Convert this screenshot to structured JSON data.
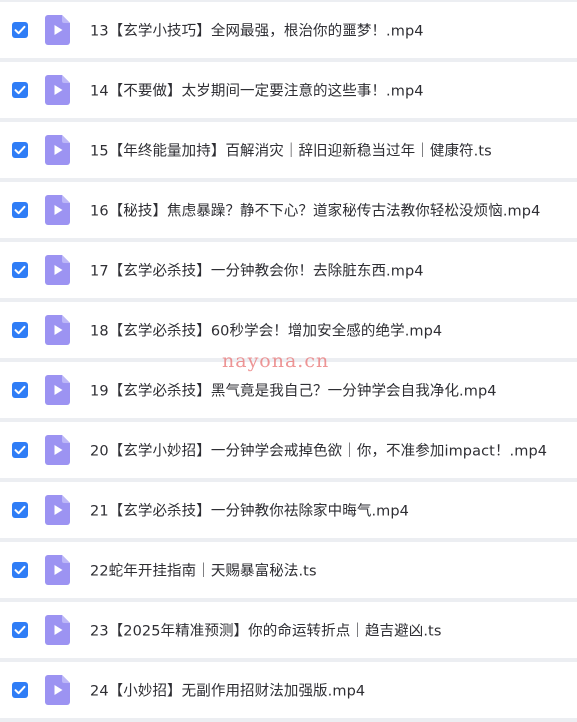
{
  "files": [
    {
      "name": "13【玄学小技巧】全网最强，根治你的噩梦！.mp4",
      "checked": true,
      "icon": "video-file-icon"
    },
    {
      "name": "14【不要做】太岁期间一定要注意的这些事！.mp4",
      "checked": true,
      "icon": "video-file-icon"
    },
    {
      "name": "15【年终能量加持】百解消灾｜辞旧迎新稳当过年｜健康符.ts",
      "checked": true,
      "icon": "video-file-icon"
    },
    {
      "name": "16【秘技】焦虑暴躁？静不下心？道家秘传古法教你轻松没烦恼.mp4",
      "checked": true,
      "icon": "video-file-icon"
    },
    {
      "name": "17【玄学必杀技】一分钟教会你！去除脏东西.mp4",
      "checked": true,
      "icon": "video-file-icon"
    },
    {
      "name": "18【玄学必杀技】60秒学会！增加安全感的绝学.mp4",
      "checked": true,
      "icon": "video-file-icon"
    },
    {
      "name": "19【玄学必杀技】黑气竟是我自己？一分钟学会自我净化.mp4",
      "checked": true,
      "icon": "video-file-icon"
    },
    {
      "name": "20【玄学小妙招】一分钟学会戒掉色欲｜你，不准参加impact！.mp4",
      "checked": true,
      "icon": "video-file-icon"
    },
    {
      "name": "21【玄学必杀技】一分钟教你祛除家中晦气.mp4",
      "checked": true,
      "icon": "video-file-icon"
    },
    {
      "name": "22蛇年开挂指南｜天赐暴富秘法.ts",
      "checked": true,
      "icon": "video-file-icon"
    },
    {
      "name": "23【2025年精准预测】你的命运转折点｜趋吉避凶.ts",
      "checked": true,
      "icon": "video-file-icon"
    },
    {
      "name": "24【小妙招】无副作用招财法加强版.mp4",
      "checked": true,
      "icon": "video-file-icon"
    }
  ],
  "watermark": "nayona.cn",
  "colors": {
    "checkbox": "#2f7df6",
    "file_icon": "#9c93f2",
    "file_icon_play": "#ffffff",
    "row_background": "#ffffff",
    "separator": "#eceef2"
  }
}
